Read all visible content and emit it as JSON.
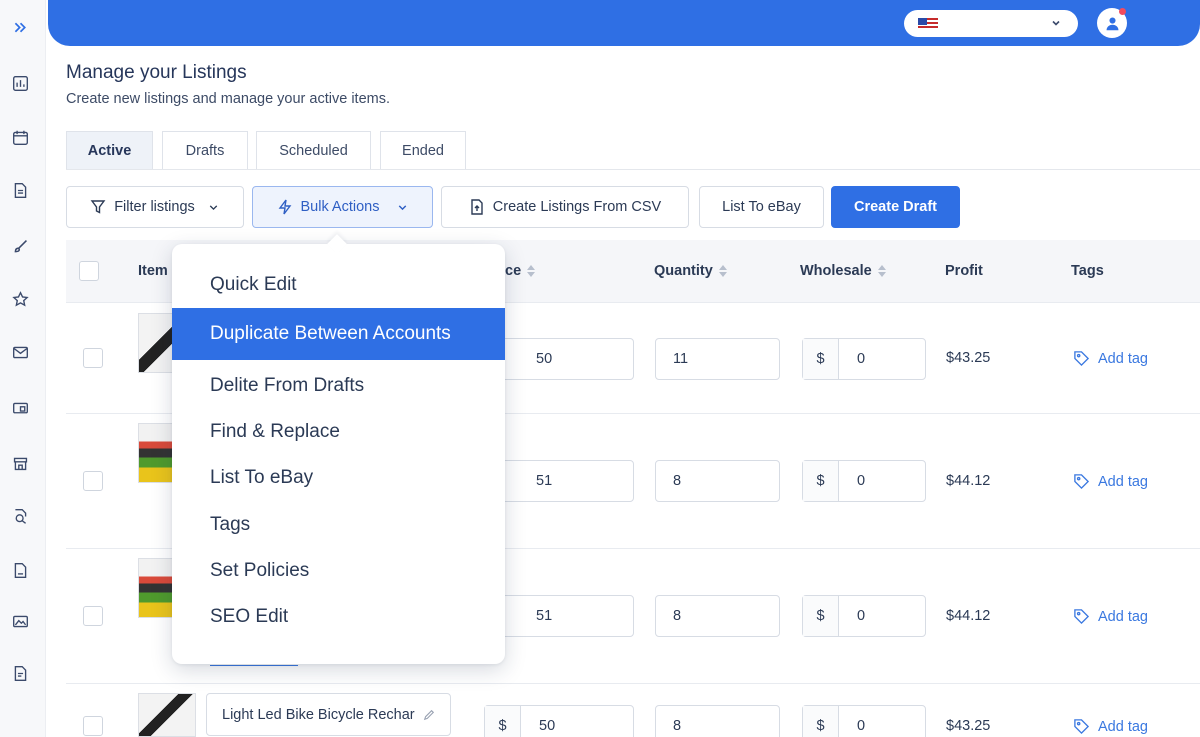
{
  "sidebar": {
    "items": [
      "expand-icon",
      "dashboard-icon",
      "calendar-icon",
      "document-icon",
      "brush-icon",
      "star-icon",
      "mail-icon",
      "monitor-icon",
      "store-icon",
      "search-doc-icon",
      "file-icon",
      "image-icon",
      "report-icon"
    ]
  },
  "header": {
    "accent_color": "#2f6fe4",
    "language_flag": "us-flag-icon"
  },
  "page": {
    "title": "Manage your Listings",
    "subtitle": "Create new listings and manage your active items."
  },
  "tabs": [
    {
      "label": "Active",
      "active": true
    },
    {
      "label": "Drafts",
      "active": false
    },
    {
      "label": "Scheduled",
      "active": false
    },
    {
      "label": "Ended",
      "active": false
    }
  ],
  "toolbar": {
    "filter_label": "Filter listings",
    "bulk_label": "Bulk Actions",
    "csv_label": "Create Listings From CSV",
    "list_ebay_label": "List To eBay",
    "create_draft_label": "Create Draft"
  },
  "table": {
    "headers": {
      "item": "Item",
      "price": "ce",
      "quantity": "Quantity",
      "wholesale": "Wholesale",
      "profit": "Profit",
      "tags": "Tags"
    },
    "rows": [
      {
        "price": "50",
        "quantity": "11",
        "wholesale_currency": "$",
        "wholesale": "0",
        "profit": "$43.25",
        "tag_label": "Add tag"
      },
      {
        "price": "51",
        "quantity": "8",
        "wholesale_currency": "$",
        "wholesale": "0",
        "profit": "$44.12",
        "tag_label": "Add tag"
      },
      {
        "price": "51",
        "quantity": "8",
        "wholesale_currency": "$",
        "wholesale": "0",
        "profit": "$44.12",
        "tag_label": "Add tag"
      },
      {
        "title": "Light Led Bike Bicycle Rechar",
        "price_currency": "$",
        "price": "50",
        "quantity": "8",
        "wholesale_currency": "$",
        "wholesale": "0",
        "profit": "$43.25",
        "tag_label": "Add tag"
      }
    ]
  },
  "bulk_menu": {
    "items": [
      "Quick Edit",
      "Duplicate Between Accounts",
      "Delite From Drafts",
      "Find & Replace",
      "List To eBay",
      "Tags",
      "Set Policies",
      "SEO Edit"
    ],
    "selected_index": 1
  }
}
